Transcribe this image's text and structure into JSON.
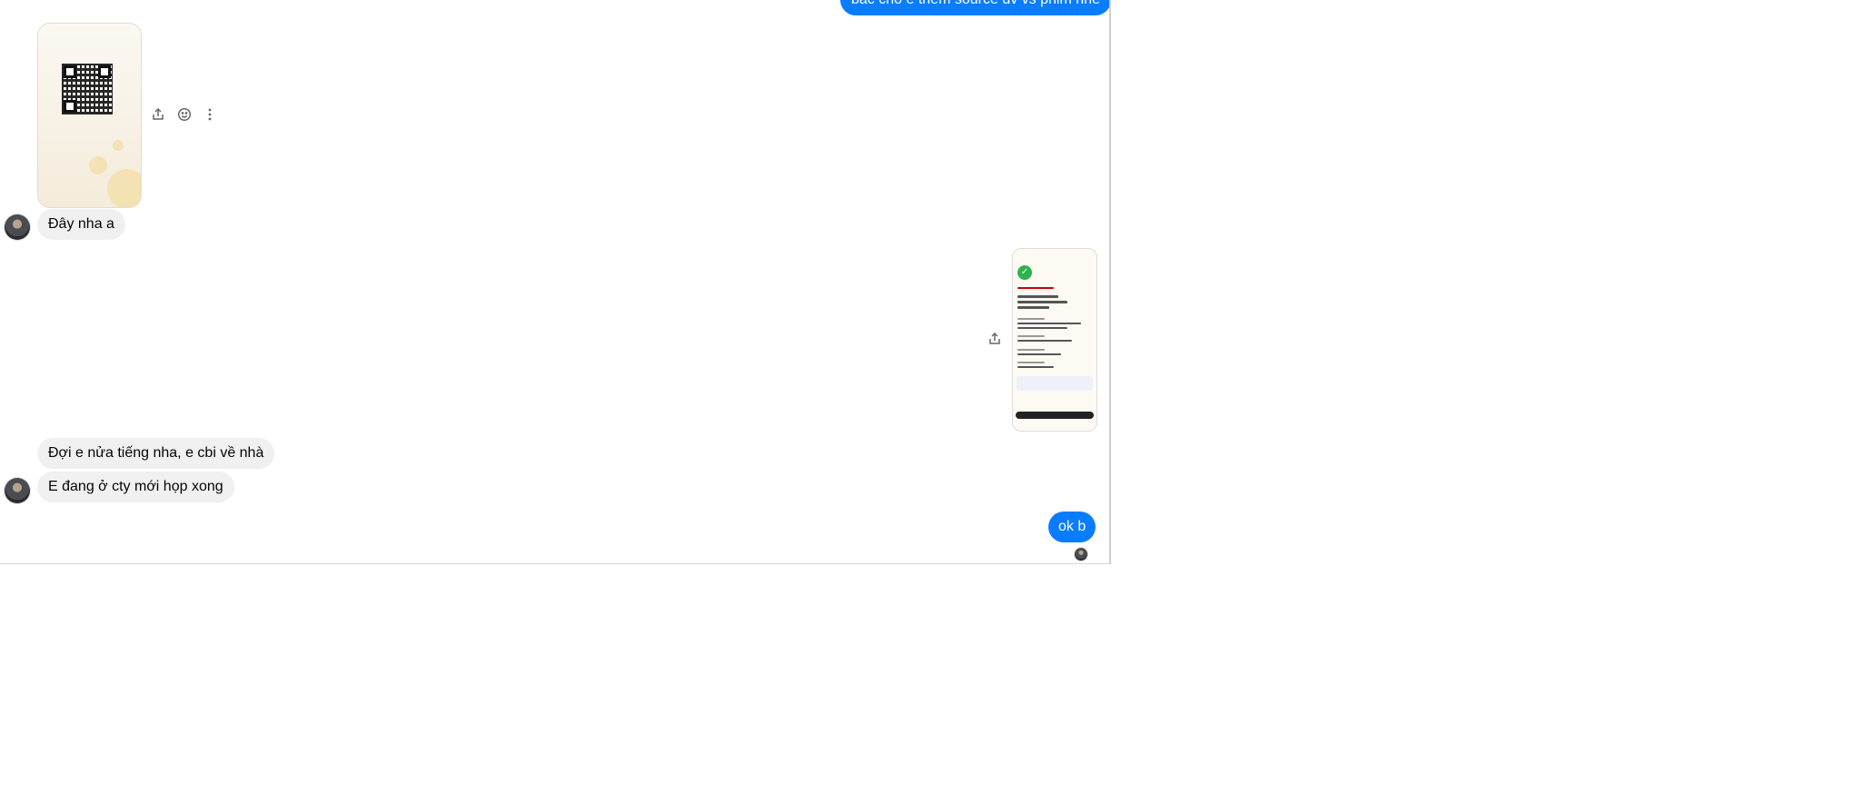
{
  "messages": {
    "top_outgoing": "bác cho e thêm source đv vs phim nhé",
    "day_nha_a": "Đây nha a",
    "doi_e": "Đợi e nửa tiếng nha, e cbi về nhà",
    "e_dang": "E đang ở cty mới họp xong",
    "ok_b": "ok b"
  },
  "message_actions": {
    "share": "share-icon",
    "react": "smiley-icon",
    "more": "more-vertical-icon"
  },
  "colors": {
    "outgoing_bubble": "#0a7cff",
    "incoming_bubble": "#f0f0f0"
  }
}
